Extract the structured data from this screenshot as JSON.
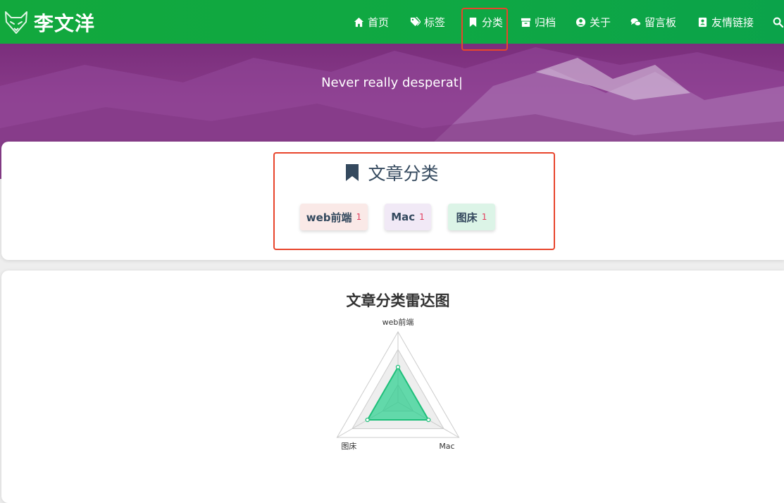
{
  "header": {
    "site_title": "李文洋",
    "nav": [
      {
        "label": "首页",
        "icon": "home-icon"
      },
      {
        "label": "标签",
        "icon": "tags-icon"
      },
      {
        "label": "分类",
        "icon": "bookmark-icon"
      },
      {
        "label": "归档",
        "icon": "archive-icon"
      },
      {
        "label": "关于",
        "icon": "user-circle-icon"
      },
      {
        "label": "留言板",
        "icon": "comments-icon"
      },
      {
        "label": "友情链接",
        "icon": "address-card-icon"
      }
    ],
    "search_icon": "search-icon",
    "colors": {
      "nav_green": "#0fa843",
      "highlight": "#e8452c"
    }
  },
  "banner": {
    "typed_text": "Never really desperat|",
    "color": "#8a3f89"
  },
  "categories": {
    "title": "文章分类",
    "items": [
      {
        "name": "web前端",
        "count": "1"
      },
      {
        "name": "Mac",
        "count": "1"
      },
      {
        "name": "图床",
        "count": "1"
      }
    ]
  },
  "radar": {
    "title": "文章分类雷达图",
    "chart_data": {
      "type": "radar",
      "indicators": [
        "web前端",
        "Mac",
        "图床"
      ],
      "values": [
        1,
        1,
        1
      ],
      "max": 2,
      "fill_color": "#2ecc8e"
    }
  }
}
